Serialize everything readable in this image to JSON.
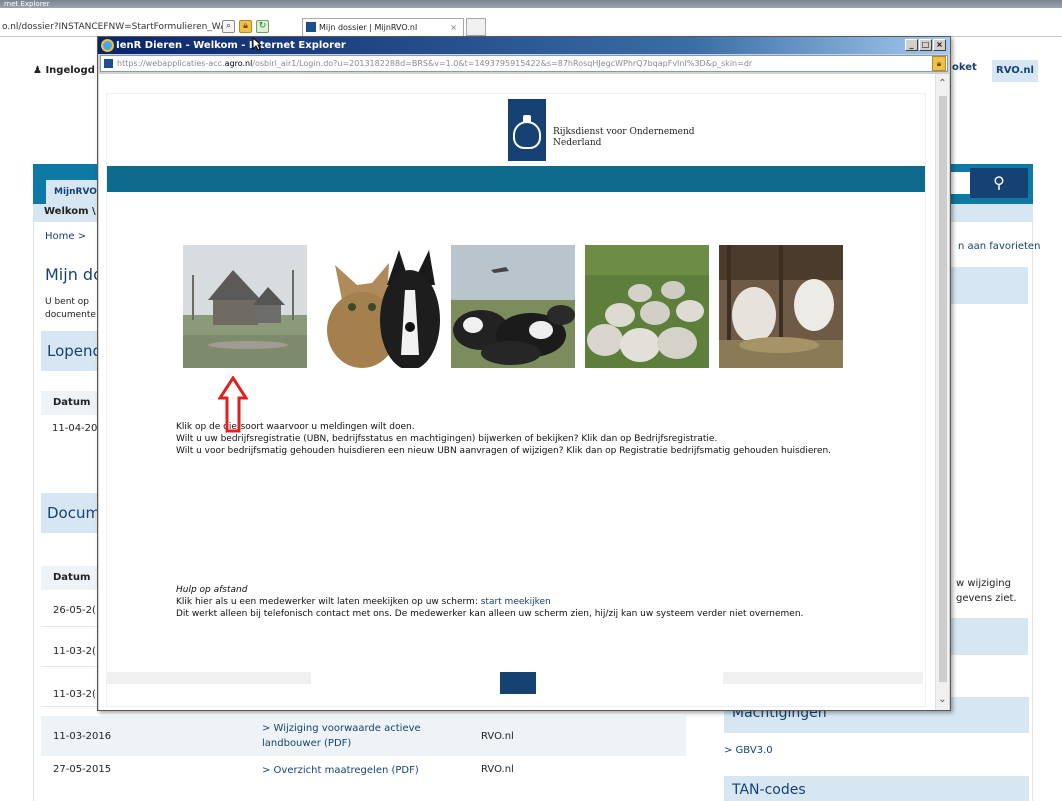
{
  "background": {
    "window_title": "rnet Explorer",
    "address": "o.nl/dossier?INSTANCEFNW=StartFormulieren_WAR",
    "tab_title": "Mijn dossier | MijnRVO.nl",
    "tab_close": "×",
    "user": "Ingelogd",
    "loket": "oket",
    "rvo_button": "RVO.nl",
    "tab_mijn": "MijnRVO",
    "welkom": "Welkom \\",
    "home": "Home  >",
    "favorieten": "n aan favorieten",
    "page_title": "Mijn dos",
    "intro_line1": "U bent op",
    "intro_line2": "documente",
    "lopend": "Lopend",
    "datum_header": "Datum",
    "lopend_date": "11-04-20",
    "documenten": "Docum",
    "right_text_line1": "w wijziging",
    "right_text_line2": "gevens ziet.",
    "rows": [
      {
        "date": "26-05-2(",
        "link": "",
        "source": ""
      },
      {
        "date": "11-03-2(",
        "link": "",
        "source": ""
      },
      {
        "date": "11-03-2(",
        "link": "",
        "source": ""
      },
      {
        "date": "11-03-2016",
        "link": "> Wijziging voorwaarde actieve landbouwer (PDF)",
        "source": "RVO.nl"
      },
      {
        "date": "27-05-2015",
        "link": "> Overzicht maatregelen (PDF)",
        "source": "RVO.nl"
      }
    ],
    "machtigingen": "Machtigingen",
    "gbv": "> GBV3.0",
    "tan": "TAN-codes"
  },
  "popup": {
    "title": "IenR Dieren - Welkom - Internet Explorer",
    "btn_min": "_",
    "btn_max": "□",
    "btn_close": "×",
    "url_prefix": "https://webapplicaties-acc.",
    "url_host": "agro.nl",
    "url_rest": "/osbiri_air1/Login.do?u=2013182288d=BRS&v=1.0&t=1493795915422&s=87hRosqHJegcWPhrQ7bqapFvInI%3D&p_skin=dr",
    "logo_line1": "Rijksdienst voor Ondernemend",
    "logo_line2": "Nederland",
    "photos": [
      "farm-photo",
      "pets-photo",
      "cows-photo",
      "sheep-photo",
      "goats-photo"
    ],
    "instr_line1": "Klik op de diersoort waarvoor u meldingen wilt doen.",
    "instr_line2": "Wilt u uw bedrijfsregistratie (UBN, bedrijfsstatus en machtigingen) bijwerken of bekijken? Klik dan op Bedrijfsregistratie.",
    "instr_line3": "Wilt u voor bedrijfsmatig gehouden huisdieren een nieuw UBN aanvragen of wijzigen? Klik dan op Registratie bedrijfsmatig gehouden huisdieren.",
    "hulp_title": "Hulp op afstand",
    "hulp_line1": "Klik hier als u een medewerker wilt laten meekijken op uw scherm: ",
    "hulp_link": "start meekijken",
    "hulp_line2": "Dit werkt alleen bij telefonisch contact met ons. De medewerker kan alleen uw scherm zien, hij/zij kan uw systeem verder niet overnemen."
  },
  "colors": {
    "rijks_blue": "#154273",
    "teal": "#0f6b8c",
    "light_blue": "#d6e7f3",
    "annotation_red": "#e02020"
  }
}
